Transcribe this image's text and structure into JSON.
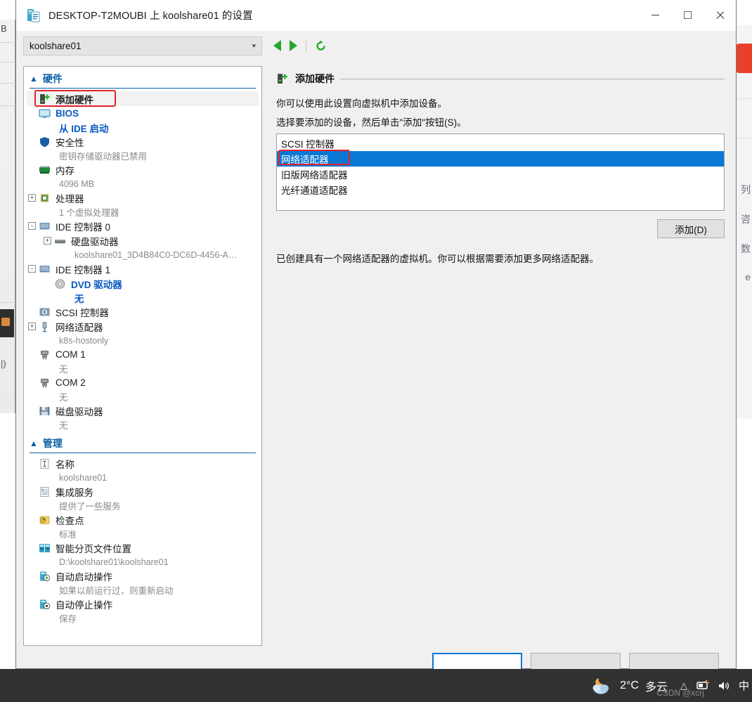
{
  "window": {
    "title": "DESKTOP-T2MOUBI 上 koolshare01 的设置",
    "title_icon": "vm-settings-icon",
    "controls": {
      "minimize": "minimize-icon",
      "maximize": "maximize-icon",
      "close": "close-icon"
    }
  },
  "toolbar": {
    "vm_name": "koolshare01",
    "dropdown_caret": "chevron-down-icon",
    "back": "back-arrow-icon",
    "forward": "forward-arrow-icon",
    "refresh": "refresh-icon"
  },
  "tree": {
    "sections": [
      {
        "title": "硬件",
        "chevron": "chevron-up-icon"
      },
      {
        "title": "管理",
        "chevron": "chevron-up-icon"
      }
    ],
    "hardware_items": [
      {
        "label": "添加硬件",
        "icon": "add-hardware-icon",
        "selected": true,
        "highlighted": true
      },
      {
        "label": "BIOS",
        "icon": "bios-monitor-icon",
        "style": "blue",
        "sub": "从 IDE 启动",
        "sub_style": "blue"
      },
      {
        "label": "安全性",
        "icon": "shield-icon",
        "sub": "密钥存储驱动器已禁用"
      },
      {
        "label": "内存",
        "icon": "memory-icon",
        "sub": "4096 MB"
      },
      {
        "label": "处理器",
        "icon": "processor-icon",
        "expander": "+",
        "sub": "1 个虚拟处理器"
      },
      {
        "label": "IDE 控制器 0",
        "icon": "ide-controller-icon",
        "expander": "-"
      },
      {
        "label": "硬盘驱动器",
        "icon": "hard-drive-icon",
        "expander": "+",
        "indent": true,
        "sub": "koolshare01_3D4B84C0-DC6D-4456-A…"
      },
      {
        "label": "IDE 控制器 1",
        "icon": "ide-controller-icon",
        "expander": "-"
      },
      {
        "label": "DVD 驱动器",
        "icon": "dvd-drive-icon",
        "style": "blue",
        "indent": true,
        "sub": "无",
        "sub_style": "blue"
      },
      {
        "label": "SCSI 控制器",
        "icon": "scsi-controller-icon"
      },
      {
        "label": "网络适配器",
        "icon": "network-adapter-icon",
        "expander": "+",
        "sub": "k8s-hostonly"
      },
      {
        "label": "COM 1",
        "icon": "com-port-icon",
        "sub": "无"
      },
      {
        "label": "COM 2",
        "icon": "com-port-icon",
        "sub": "无"
      },
      {
        "label": "磁盘驱动器",
        "icon": "floppy-drive-icon",
        "sub": "无"
      }
    ],
    "management_items": [
      {
        "label": "名称",
        "icon": "name-icon",
        "sub": "koolshare01"
      },
      {
        "label": "集成服务",
        "icon": "integration-services-icon",
        "sub": "提供了一些服务"
      },
      {
        "label": "检查点",
        "icon": "checkpoint-icon",
        "sub": "标准"
      },
      {
        "label": "智能分页文件位置",
        "icon": "smart-paging-icon",
        "sub": "D:\\koolshare01\\koolshare01"
      },
      {
        "label": "自动启动操作",
        "icon": "automatic-start-icon",
        "sub": "如果以前运行过，则重新启动"
      },
      {
        "label": "自动停止操作",
        "icon": "automatic-stop-icon",
        "sub": "保存"
      }
    ]
  },
  "content": {
    "header": "添加硬件",
    "header_icon": "add-hardware-icon",
    "description_1": "你可以使用此设置向虚拟机中添加设备。",
    "description_2": "选择要添加的设备，然后单击\"添加\"按钮(S)。",
    "device_list": [
      {
        "label": "SCSI 控制器",
        "selected": false
      },
      {
        "label": "网络适配器",
        "selected": true,
        "highlighted": true
      },
      {
        "label": "旧版网络适配器",
        "selected": false
      },
      {
        "label": "光纤通道适配器",
        "selected": false
      }
    ],
    "add_button": "添加(D)",
    "note": "已创建具有一个网络适配器的虚拟机。你可以根据需要添加更多网络适配器。"
  },
  "footer": {
    "buttons": [
      {
        "name": "ok",
        "primary": true
      },
      {
        "name": "cancel",
        "primary": false
      },
      {
        "name": "apply",
        "primary": false
      }
    ]
  },
  "taskbar": {
    "weather_icon": "moon-cloud-icon",
    "temperature": "2°C",
    "condition": "多云",
    "show_hidden_icons": "chevron-up-icon",
    "network_icon": "network-tray-icon",
    "volume_icon": "volume-tray-icon",
    "ime_indicator": "中",
    "watermark": "CSDN @xcrj"
  },
  "background": {
    "left_letter": "B",
    "left_paren": "|)",
    "right_chars": [
      "列",
      "咨",
      "数",
      "e"
    ]
  },
  "colors": {
    "accent_blue": "#0a78d4",
    "tree_blue": "#0a58c2",
    "section_blue": "#0b5fa4",
    "annotation_red": "#e8202a",
    "nav_green": "#27a727",
    "taskbar": "#323232"
  }
}
